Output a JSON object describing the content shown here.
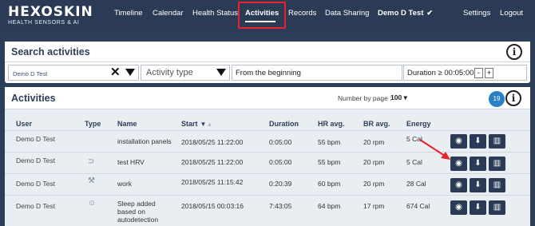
{
  "brand": {
    "name": "HEXOSKIN",
    "tagline": "HEALTH SENSORS & AI"
  },
  "nav": {
    "items": [
      {
        "label": "Timeline"
      },
      {
        "label": "Calendar"
      },
      {
        "label": "Health Status"
      },
      {
        "label": "Activities"
      },
      {
        "label": "Records"
      },
      {
        "label": "Data Sharing"
      },
      {
        "label": "Demo D Test"
      },
      {
        "label": "Settings"
      },
      {
        "label": "Logout"
      }
    ],
    "active": "Activities"
  },
  "search": {
    "title": "Search activities",
    "user_value": "Demo D Test",
    "activity_type_placeholder": "Activity type",
    "from_value": "From the beginning",
    "duration_label": "Duration ≥ 00:05:00",
    "minus": "-",
    "plus": "+"
  },
  "activities": {
    "title": "Activities",
    "per_page_label": "Number by page :",
    "per_page_value": "100",
    "count": "19",
    "columns": {
      "user": "User",
      "type": "Type",
      "name": "Name",
      "start": "Start",
      "duration": "Duration",
      "hr": "HR avg.",
      "br": "BR avg.",
      "energy": "Energy"
    },
    "rows": [
      {
        "user": "Demo D Test",
        "name": "installation panels",
        "start": "2018/05/25 11:22:00",
        "duration": "0:05:00",
        "hr": "55 bpm",
        "br": "20 rpm",
        "energy": "5 Cal",
        "type_icon": "none"
      },
      {
        "user": "Demo D Test",
        "name": "test HRV",
        "start": "2018/05/25 11:22:00",
        "duration": "0:05:00",
        "hr": "55 bpm",
        "br": "20 rpm",
        "energy": "5 Cal",
        "type_icon": "rest-icon"
      },
      {
        "user": "Demo D Test",
        "name": "work",
        "start": "2018/05/25 11:15:42",
        "duration": "0:20:39",
        "hr": "60 bpm",
        "br": "20 rpm",
        "energy": "28 Cal",
        "type_icon": "work-icon"
      },
      {
        "user": "Demo D Test",
        "name": "Sleep added based on autodetection",
        "start": "2018/05/15 00:03:16",
        "duration": "7:43:05",
        "hr": "64 bpm",
        "br": "17 rpm",
        "energy": "674 Cal",
        "type_icon": "sleep-icon"
      }
    ]
  },
  "colors": {
    "nav_bg": "#2b3b56",
    "accent_red": "#e8232b",
    "badge_blue": "#2a7fc7"
  }
}
